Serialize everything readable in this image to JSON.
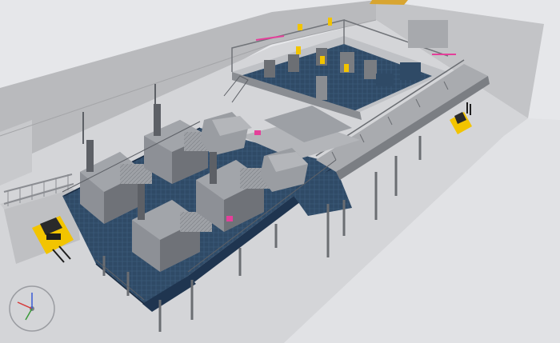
{
  "viewport": {
    "kind": "3D plant layout view",
    "background": "#e6e7ea",
    "colors": {
      "wall": "#b9babd",
      "floor": "#d4d5d8",
      "equipment": "#8d9096",
      "equipment_dark": "#5d6066",
      "walkway": "#2f4a66",
      "safety_yellow": "#f2c400",
      "accent_magenta": "#e4409a"
    }
  },
  "objects": {
    "forklifts": [
      {
        "id": "forklift-left",
        "color": "#f2c400"
      },
      {
        "id": "forklift-right",
        "color": "#f2c400"
      }
    ],
    "machine_units": [
      "unit-1",
      "unit-2",
      "unit-3",
      "unit-4",
      "unit-5",
      "unit-6"
    ],
    "navigation_gizmo": {
      "axes": [
        "x",
        "y",
        "z"
      ],
      "axis_colors": [
        "#d63a3a",
        "#3a9a3a",
        "#3a5ad6"
      ]
    }
  }
}
